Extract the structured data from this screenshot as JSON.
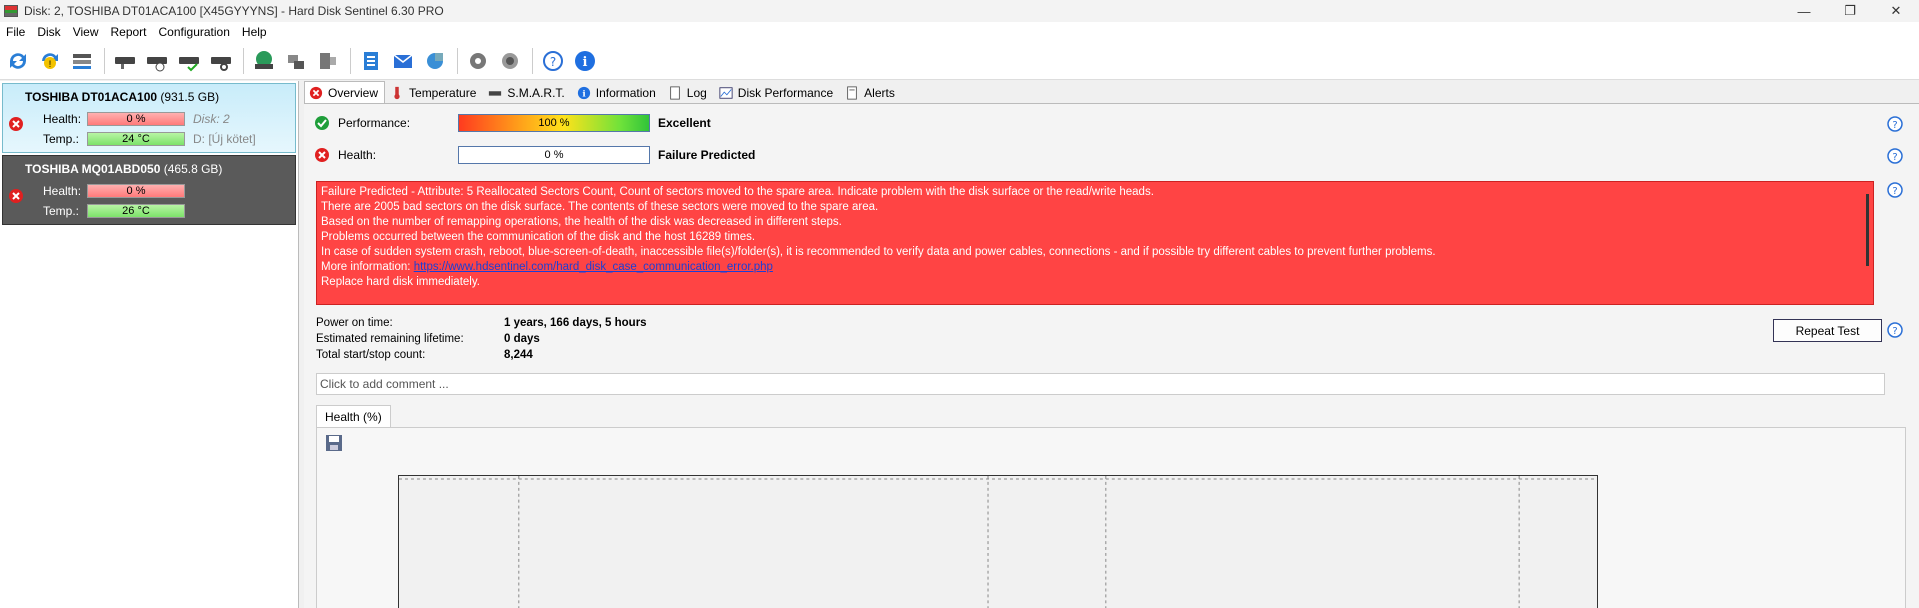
{
  "window": {
    "title": "Disk: 2, TOSHIBA DT01ACA100 [X45GYYYNS]  -  Hard Disk Sentinel 6.30 PRO",
    "controls": [
      "—",
      "❐",
      "✕"
    ]
  },
  "menu": [
    {
      "label": "File"
    },
    {
      "label": "Disk"
    },
    {
      "label": "View"
    },
    {
      "label": "Report"
    },
    {
      "label": "Configuration"
    },
    {
      "label": "Help"
    }
  ],
  "disks": [
    {
      "name": "TOSHIBA DT01ACA100",
      "size": "(931.5 GB)",
      "health_label": "Health:",
      "health": "0 %",
      "temp_label": "Temp.:",
      "temp": "24 °C",
      "extra1": "Disk: 2",
      "extra2": "D: [Új kötet]"
    },
    {
      "name": "TOSHIBA MQ01ABD050",
      "size": "(465.8 GB)",
      "health_label": "Health:",
      "health": "0 %",
      "temp_label": "Temp.:",
      "temp": "26 °C"
    }
  ],
  "tabs": [
    {
      "label": "Overview",
      "active": true
    },
    {
      "label": "Temperature"
    },
    {
      "label": "S.M.A.R.T."
    },
    {
      "label": "Information"
    },
    {
      "label": "Log"
    },
    {
      "label": "Disk Performance"
    },
    {
      "label": "Alerts"
    }
  ],
  "overview": {
    "performance_label": "Performance:",
    "performance_value": "100 %",
    "performance_verdict": "Excellent",
    "health_label": "Health:",
    "health_value": "0 %",
    "health_verdict": "Failure Predicted",
    "messages": [
      "Failure Predicted - Attribute: 5 Reallocated Sectors Count, Count of sectors moved to the spare area. Indicate problem with the disk surface or the read/write heads.",
      "There are 2005 bad sectors on the disk surface. The contents of these sectors were moved to the spare area.",
      "Based on the number of remapping operations, the health of the disk was decreased in different steps.",
      "Problems occurred between the communication of the disk and the host 16289 times.",
      "In case of sudden system crash, reboot, blue-screen-of-death, inaccessible file(s)/folder(s), it is recommended to verify data and power cables, connections - and if possible try different cables to prevent further problems."
    ],
    "more_info_label": "More information: ",
    "more_info_link": "https://www.hdsentinel.com/hard_disk_case_communication_error.php",
    "final_message": "Replace hard disk immediately.",
    "power_on_label": "Power on time:",
    "power_on_value": "1 years, 166 days, 5 hours",
    "remaining_label": "Estimated remaining lifetime:",
    "remaining_value": "0 days",
    "startstop_label": "Total start/stop count:",
    "startstop_value": "8,244",
    "repeat_button": "Repeat Test",
    "comment_placeholder": "Click to add comment ...",
    "chart_tab": "Health (%)"
  }
}
